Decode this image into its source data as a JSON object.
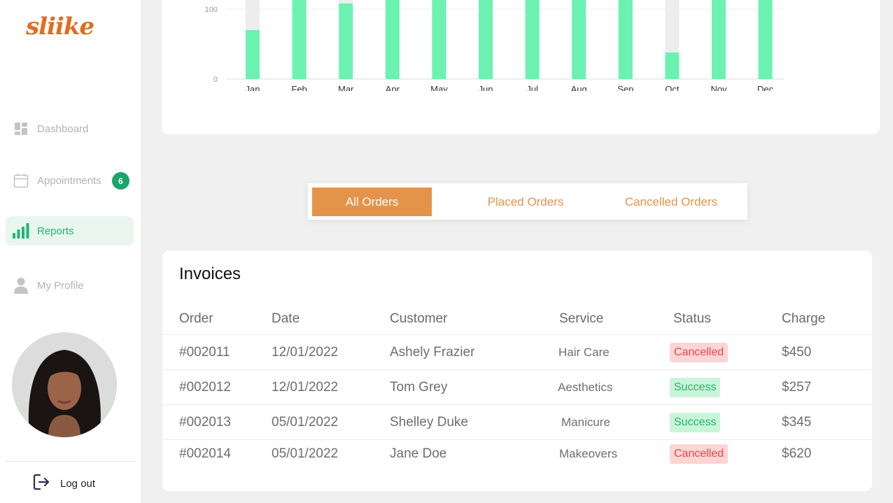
{
  "app": {
    "logo_text": "sliike"
  },
  "sidebar": {
    "items": [
      {
        "label": "Dashboard",
        "icon": "dashboard-icon"
      },
      {
        "label": "Appointments",
        "icon": "calendar-icon",
        "badge": "6"
      },
      {
        "label": "Reports",
        "icon": "bar-chart-icon",
        "active": true
      },
      {
        "label": "My Profile",
        "icon": "user-icon"
      }
    ],
    "logout_label": "Log out"
  },
  "chart_data": {
    "type": "bar",
    "categories": [
      "Jan",
      "Feb",
      "Mar",
      "Apr",
      "May",
      "Jun",
      "Jul",
      "Aug",
      "Sep",
      "Oct",
      "Nov",
      "Dec"
    ],
    "values": [
      70,
      150,
      108,
      150,
      146,
      150,
      145,
      150,
      150,
      38,
      150,
      146
    ],
    "ylim": [
      0,
      150
    ],
    "yticks": [
      "0",
      "100"
    ],
    "colors": {
      "bar": "#6bf2b0",
      "track": "#ededed"
    }
  },
  "tabs": [
    {
      "label": "All Orders",
      "active": true
    },
    {
      "label": "Placed Orders",
      "active": false
    },
    {
      "label": "Cancelled Orders",
      "active": false
    }
  ],
  "invoices": {
    "title": "Invoices",
    "columns": [
      "Order",
      "Date",
      "Customer",
      "Service",
      "Status",
      "Charge"
    ],
    "rows": [
      {
        "order": "#002011",
        "date": "12/01/2022",
        "customer": "Ashely Frazier",
        "service": "Hair Care",
        "status": "Cancelled",
        "charge": "$450"
      },
      {
        "order": "#002012",
        "date": "12/01/2022",
        "customer": "Tom Grey",
        "service": "Aesthetics",
        "status": "Success",
        "charge": "$257"
      },
      {
        "order": "#002013",
        "date": "05/01/2022",
        "customer": "Shelley Duke",
        "service": "Manicure",
        "status": "Success",
        "charge": "$345"
      },
      {
        "order": "#002014",
        "date": "05/01/2022",
        "customer": "Jane Doe",
        "service": "Makeovers",
        "status": "Cancelled",
        "charge": "$620"
      }
    ]
  },
  "colors": {
    "accent": "#e4944a",
    "success": "#27b56a",
    "danger": "#e5484d",
    "brand": "#e06d1f"
  }
}
